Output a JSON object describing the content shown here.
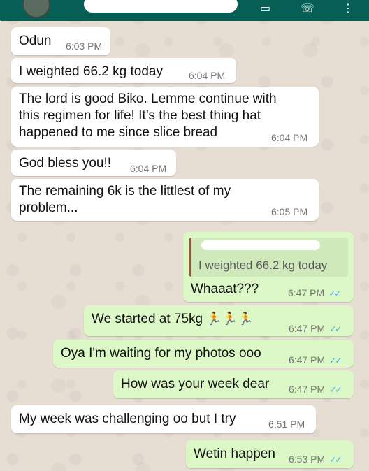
{
  "header": {
    "contact_name_redacted": "",
    "icons": [
      "avatar",
      "video-call-icon",
      "phone-icon",
      "more-icon"
    ]
  },
  "messages": [
    {
      "id": "m1",
      "dir": "in",
      "text": "Odun",
      "time": "6:03 PM"
    },
    {
      "id": "m2",
      "dir": "in",
      "text": "I weighted 66.2 kg today",
      "time": "6:04 PM"
    },
    {
      "id": "m3",
      "dir": "in",
      "lines": [
        "The lord is good Biko. Lemme continue with",
        "this regimen for life! It’s the best thing hat",
        "happened to me since slice bread"
      ],
      "time": "6:04 PM"
    },
    {
      "id": "m4",
      "dir": "in",
      "text": "God bless you!!",
      "time": "6:04 PM"
    },
    {
      "id": "m5",
      "dir": "in",
      "lines": [
        "The remaining 6k is the littlest of my",
        "problem..."
      ],
      "time": "6:05 PM"
    },
    {
      "id": "m6",
      "dir": "out",
      "quote": "I weighted 66.2 kg today",
      "text": "Whaaat???",
      "time": "6:47 PM",
      "ticks": "✓✓"
    },
    {
      "id": "m7",
      "dir": "out",
      "text": "We started at 75kg",
      "emoji": "🏃🏃🏃",
      "time": "6:47 PM",
      "ticks": "✓✓"
    },
    {
      "id": "m8",
      "dir": "out",
      "text": "Oya I'm waiting for my photos ooo",
      "time": "6:47 PM",
      "ticks": "✓✓"
    },
    {
      "id": "m9",
      "dir": "out",
      "text": "How was your week dear",
      "time": "6:47 PM",
      "ticks": "✓✓"
    },
    {
      "id": "m10",
      "dir": "in",
      "text": "My week was challenging oo but I try",
      "time": "6:51 PM"
    },
    {
      "id": "m11",
      "dir": "out",
      "text": "Wetin happen",
      "time": "6:53 PM",
      "ticks": "✓✓"
    }
  ],
  "colors": {
    "header": "#075e54",
    "incoming_bubble": "#ffffff",
    "outgoing_bubble": "#dcf8c6",
    "read_ticks": "#4fb6ec",
    "wallpaper": "#e6ddd3"
  }
}
